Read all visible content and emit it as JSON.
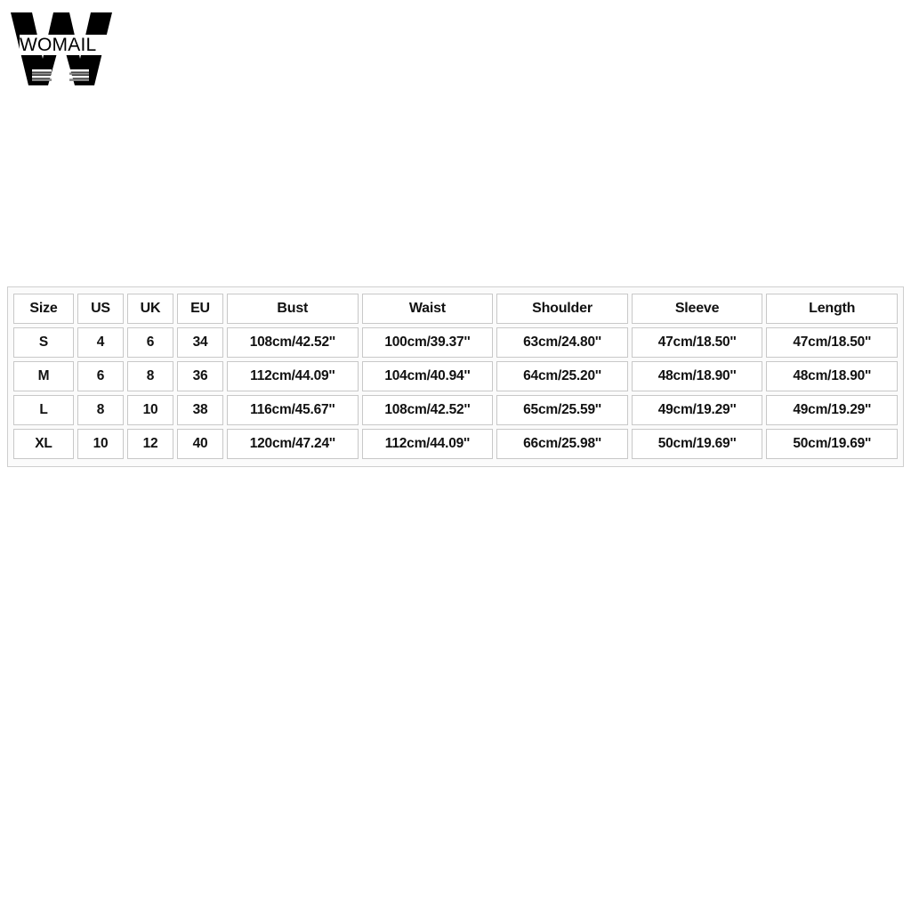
{
  "logo": {
    "name": "WOMAIL",
    "wordmark": "WOMAIL"
  },
  "size_chart": {
    "columns": [
      "Size",
      "US",
      "UK",
      "EU",
      "Bust",
      "Waist",
      "Shoulder",
      "Sleeve",
      "Length"
    ],
    "rows": [
      {
        "size": "S",
        "us": "4",
        "uk": "6",
        "eu": "34",
        "bust": "108cm/42.52''",
        "waist": "100cm/39.37''",
        "shoulder": "63cm/24.80''",
        "sleeve": "47cm/18.50''",
        "length": "47cm/18.50''"
      },
      {
        "size": "M",
        "us": "6",
        "uk": "8",
        "eu": "36",
        "bust": "112cm/44.09''",
        "waist": "104cm/40.94''",
        "shoulder": "64cm/25.20''",
        "sleeve": "48cm/18.90''",
        "length": "48cm/18.90''"
      },
      {
        "size": "L",
        "us": "8",
        "uk": "10",
        "eu": "38",
        "bust": "116cm/45.67''",
        "waist": "108cm/42.52''",
        "shoulder": "65cm/25.59''",
        "sleeve": "49cm/19.29''",
        "length": "49cm/19.29''"
      },
      {
        "size": "XL",
        "us": "10",
        "uk": "12",
        "eu": "40",
        "bust": "120cm/47.24''",
        "waist": "112cm/44.09''",
        "shoulder": "66cm/25.98''",
        "sleeve": "50cm/19.69''",
        "length": "50cm/19.69''"
      }
    ]
  },
  "colors": {
    "background": "#ffffff",
    "text": "#111111",
    "cell_border": "#c8c8c8",
    "frame_border": "#cfcfcf",
    "frame_fill": "#fbfbfb",
    "logo": "#000000",
    "logo_stripe": "#808080"
  }
}
